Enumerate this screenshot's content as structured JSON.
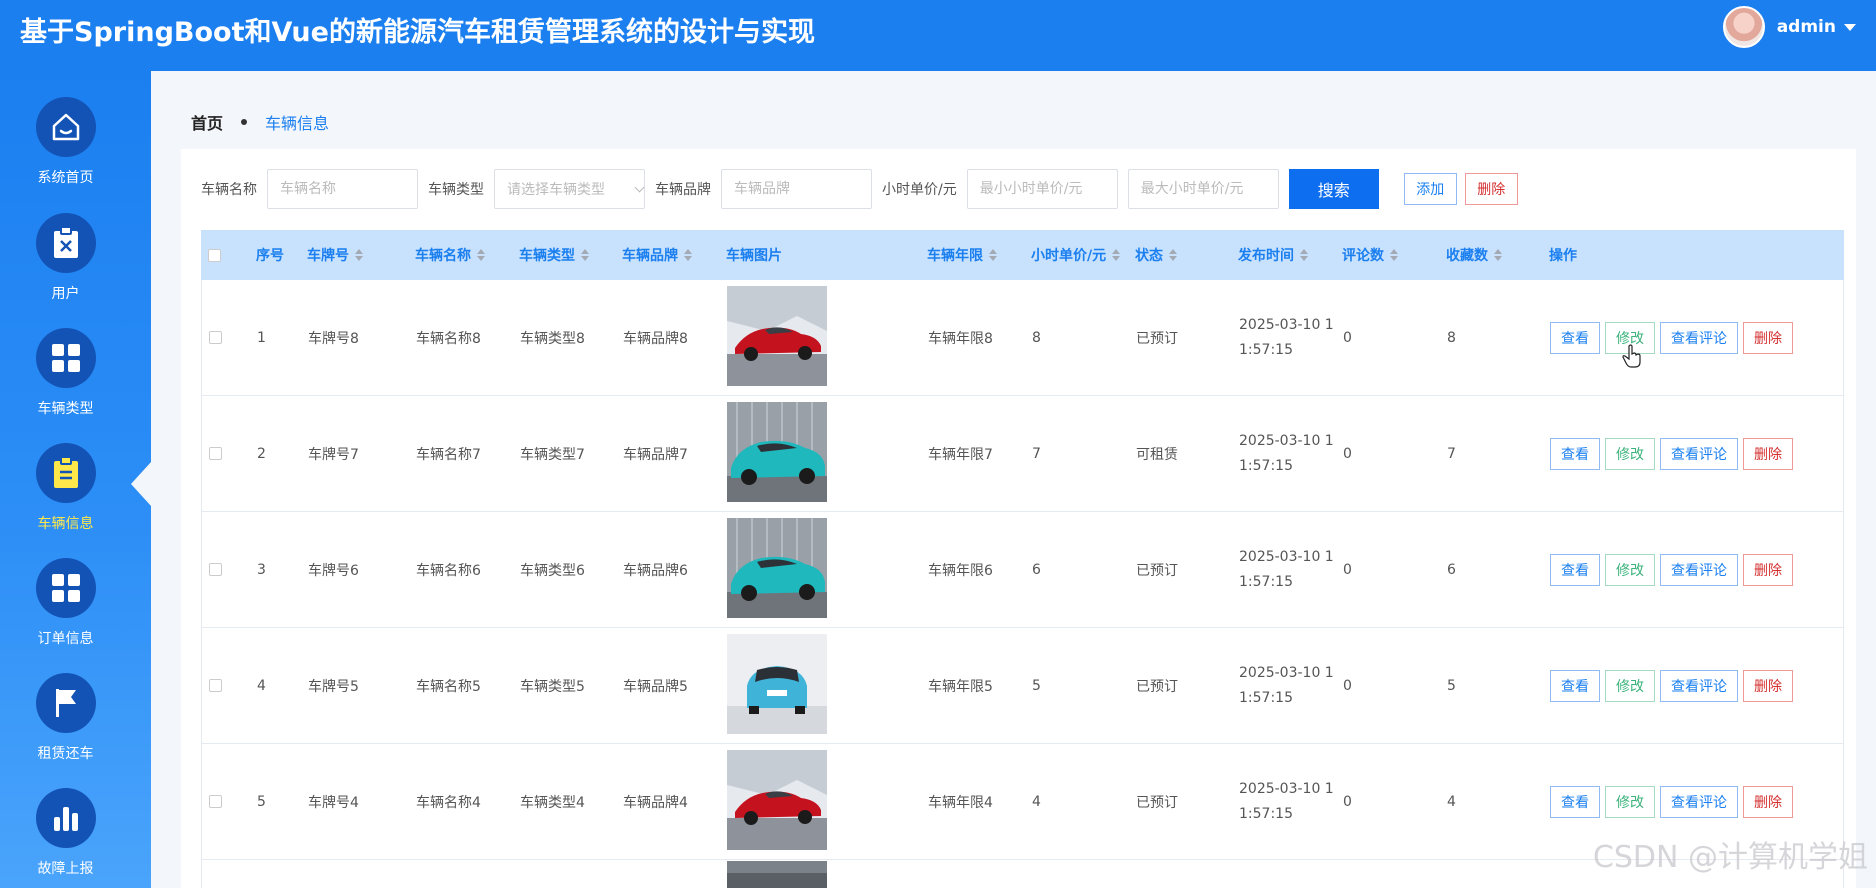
{
  "header": {
    "title": "基于SpringBoot和Vue的新能源汽车租赁管理系统的设计与实现",
    "user": "admin"
  },
  "sidebar": {
    "items": [
      {
        "label": "系统首页",
        "icon": "home-icon"
      },
      {
        "label": "用户",
        "icon": "clipboard-icon"
      },
      {
        "label": "车辆类型",
        "icon": "grid-icon"
      },
      {
        "label": "车辆信息",
        "icon": "list-clipboard-icon",
        "active": true
      },
      {
        "label": "订单信息",
        "icon": "grid-icon"
      },
      {
        "label": "租赁还车",
        "icon": "flag-icon"
      },
      {
        "label": "故障上报",
        "icon": "bar-chart-icon"
      }
    ]
  },
  "breadcrumb": {
    "home": "首页",
    "current": "车辆信息"
  },
  "search": {
    "name_label": "车辆名称",
    "name_placeholder": "车辆名称",
    "type_label": "车辆类型",
    "type_placeholder": "请选择车辆类型",
    "brand_label": "车辆品牌",
    "brand_placeholder": "车辆品牌",
    "price_label": "小时单价/元",
    "min_placeholder": "最小小时单价/元",
    "max_placeholder": "最大小时单价/元",
    "search_btn": "搜索",
    "add_btn": "添加",
    "delete_btn": "删除"
  },
  "table": {
    "headers": [
      "序号",
      "车牌号",
      "车辆名称",
      "车辆类型",
      "车辆品牌",
      "车辆图片",
      "车辆年限",
      "小时单价/元",
      "状态",
      "发布时间",
      "评论数",
      "收藏数",
      "操作"
    ],
    "actions": {
      "view": "查看",
      "edit": "修改",
      "comments": "查看评论",
      "delete": "删除"
    },
    "rows": [
      {
        "no": "1",
        "plate": "车牌号8",
        "name": "车辆名称8",
        "type": "车辆类型8",
        "brand": "车辆品牌8",
        "car": "red",
        "years": "车辆年限8",
        "price": "8",
        "status": "已预订",
        "time": "2025-03-10 11:57:15",
        "comments": "0",
        "favorites": "8"
      },
      {
        "no": "2",
        "plate": "车牌号7",
        "name": "车辆名称7",
        "type": "车辆类型7",
        "brand": "车辆品牌7",
        "car": "teal",
        "years": "车辆年限7",
        "price": "7",
        "status": "可租赁",
        "time": "2025-03-10 11:57:15",
        "comments": "0",
        "favorites": "7"
      },
      {
        "no": "3",
        "plate": "车牌号6",
        "name": "车辆名称6",
        "type": "车辆类型6",
        "brand": "车辆品牌6",
        "car": "teal",
        "years": "车辆年限6",
        "price": "6",
        "status": "已预订",
        "time": "2025-03-10 11:57:15",
        "comments": "0",
        "favorites": "6"
      },
      {
        "no": "4",
        "plate": "车牌号5",
        "name": "车辆名称5",
        "type": "车辆类型5",
        "brand": "车辆品牌5",
        "car": "blue",
        "years": "车辆年限5",
        "price": "5",
        "status": "已预订",
        "time": "2025-03-10 11:57:15",
        "comments": "0",
        "favorites": "5"
      },
      {
        "no": "5",
        "plate": "车牌号4",
        "name": "车辆名称4",
        "type": "车辆类型4",
        "brand": "车辆品牌4",
        "car": "red",
        "years": "车辆年限4",
        "price": "4",
        "status": "已预订",
        "time": "2025-03-10 11:57:15",
        "comments": "0",
        "favorites": "4"
      }
    ]
  },
  "watermark": "CSDN @计算机学姐",
  "colors": {
    "header": "#1b7ff0",
    "primary": "#0e6ef0",
    "active_label": "#ffe94a",
    "danger": "#d42f2f",
    "success": "#3cb37b"
  }
}
